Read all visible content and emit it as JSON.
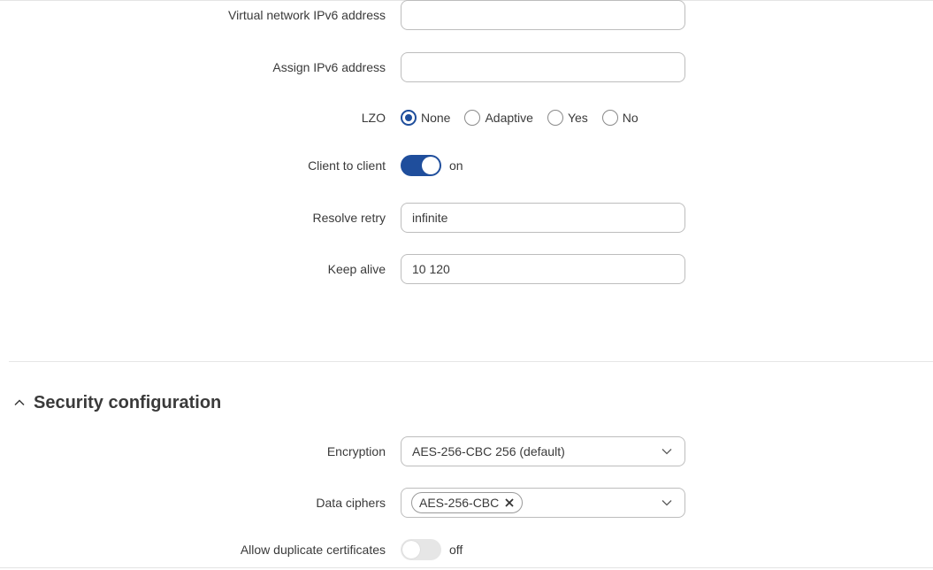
{
  "fields": {
    "ipv6_address": {
      "label": "Virtual network IPv6 address",
      "value": ""
    },
    "assign_ipv6": {
      "label": "Assign IPv6 address",
      "value": ""
    },
    "lzo": {
      "label": "LZO",
      "options": [
        "None",
        "Adaptive",
        "Yes",
        "No"
      ],
      "selected": "None"
    },
    "client_to_client": {
      "label": "Client to client",
      "state": "on",
      "enabled": true
    },
    "resolve_retry": {
      "label": "Resolve retry",
      "value": "infinite"
    },
    "keep_alive": {
      "label": "Keep alive",
      "value": "10 120"
    }
  },
  "security": {
    "title": "Security configuration",
    "encryption": {
      "label": "Encryption",
      "value": "AES-256-CBC 256 (default)"
    },
    "data_ciphers": {
      "label": "Data ciphers",
      "chips": [
        "AES-256-CBC"
      ]
    },
    "allow_duplicate_certs": {
      "label": "Allow duplicate certificates",
      "state": "off",
      "enabled": false
    }
  },
  "icons": {
    "section_toggle": "chevron-up-icon",
    "select_caret": "chevron-down-icon",
    "chip_remove": "close-icon"
  },
  "colors": {
    "accent": "#1f4e9c",
    "border": "#bdbdbd",
    "text": "#3a3a3a"
  }
}
